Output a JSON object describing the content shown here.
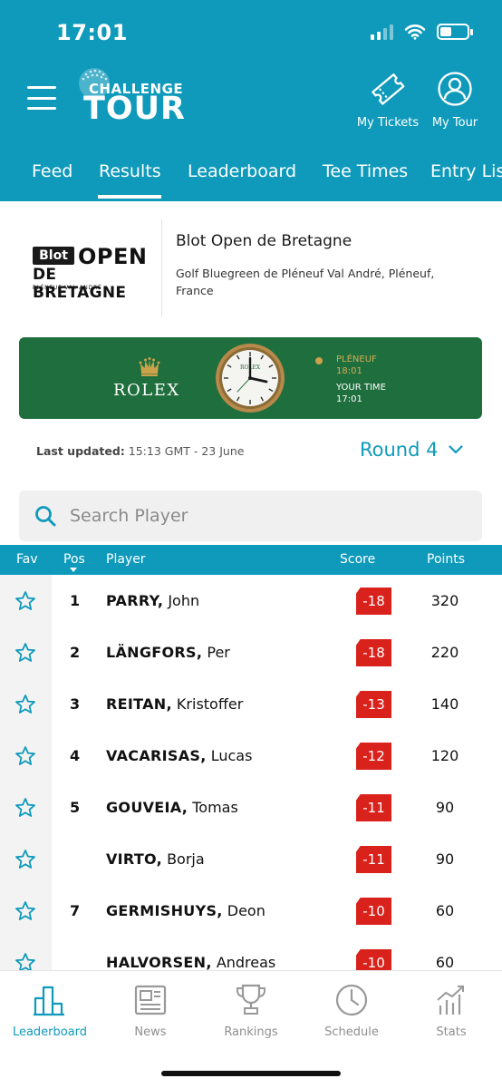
{
  "status_bar": {
    "time": "17:01"
  },
  "header": {
    "logo": {
      "small": "CHALLENGE",
      "big": "TOUR"
    },
    "actions": [
      {
        "label": "My Tickets",
        "icon": "ticket-icon"
      },
      {
        "label": "My Tour",
        "icon": "user-icon"
      }
    ]
  },
  "tabs": [
    {
      "label": "Feed"
    },
    {
      "label": "Results",
      "active": true
    },
    {
      "label": "Leaderboard"
    },
    {
      "label": "Tee Times"
    },
    {
      "label": "Entry Lis"
    }
  ],
  "event": {
    "logo": {
      "blot": "Blot",
      "open": "OPEN",
      "line2": "DE BRETAGNE",
      "line3": "PLÉNEUF-VAL-ANDRÉ"
    },
    "title": "Blot Open de Bretagne",
    "venue": "Golf Bluegreen de Pléneuf Val André, Pléneuf, France"
  },
  "rolex_banner": {
    "brand": "ROLEX",
    "clock_logo": "ROLEX",
    "local_label": "PLÉNEUF",
    "local_time": "18:01",
    "your_label": "YOUR TIME",
    "your_time": "17:01"
  },
  "update_bar": {
    "label": "Last updated:",
    "value": "15:13 GMT - 23 June",
    "round": "Round 4"
  },
  "search": {
    "placeholder": "Search Player"
  },
  "table": {
    "headers": {
      "fav": "Fav",
      "pos": "Pos",
      "player": "Player",
      "score": "Score",
      "points": "Points"
    },
    "rows": [
      {
        "pos": "1",
        "last": "PARRY,",
        "first": "John",
        "score": "-18",
        "points": "320"
      },
      {
        "pos": "2",
        "last": "LÄNGFORS,",
        "first": "Per",
        "score": "-18",
        "points": "220"
      },
      {
        "pos": "3",
        "last": "REITAN,",
        "first": "Kristoffer",
        "score": "-13",
        "points": "140"
      },
      {
        "pos": "4",
        "last": "VACARISAS,",
        "first": "Lucas",
        "score": "-12",
        "points": "120"
      },
      {
        "pos": "5",
        "last": "GOUVEIA,",
        "first": "Tomas",
        "score": "-11",
        "points": "90"
      },
      {
        "pos": "",
        "last": "VIRTO,",
        "first": "Borja",
        "score": "-11",
        "points": "90"
      },
      {
        "pos": "7",
        "last": "GERMISHUYS,",
        "first": "Deon",
        "score": "-10",
        "points": "60"
      },
      {
        "pos": "",
        "last": "HALVORSEN,",
        "first": "Andreas",
        "score": "-10",
        "points": "60"
      }
    ]
  },
  "bottom_nav": [
    {
      "label": "Leaderboard",
      "icon": "leaderboard-icon",
      "active": true
    },
    {
      "label": "News",
      "icon": "news-icon"
    },
    {
      "label": "Rankings",
      "icon": "trophy-icon"
    },
    {
      "label": "Schedule",
      "icon": "clock-icon"
    },
    {
      "label": "Stats",
      "icon": "stats-icon"
    }
  ],
  "colors": {
    "primary": "#0f9abb",
    "score_red": "#d9221c",
    "rolex_green": "#1f6e3e",
    "rolex_gold": "#c9a24a"
  }
}
